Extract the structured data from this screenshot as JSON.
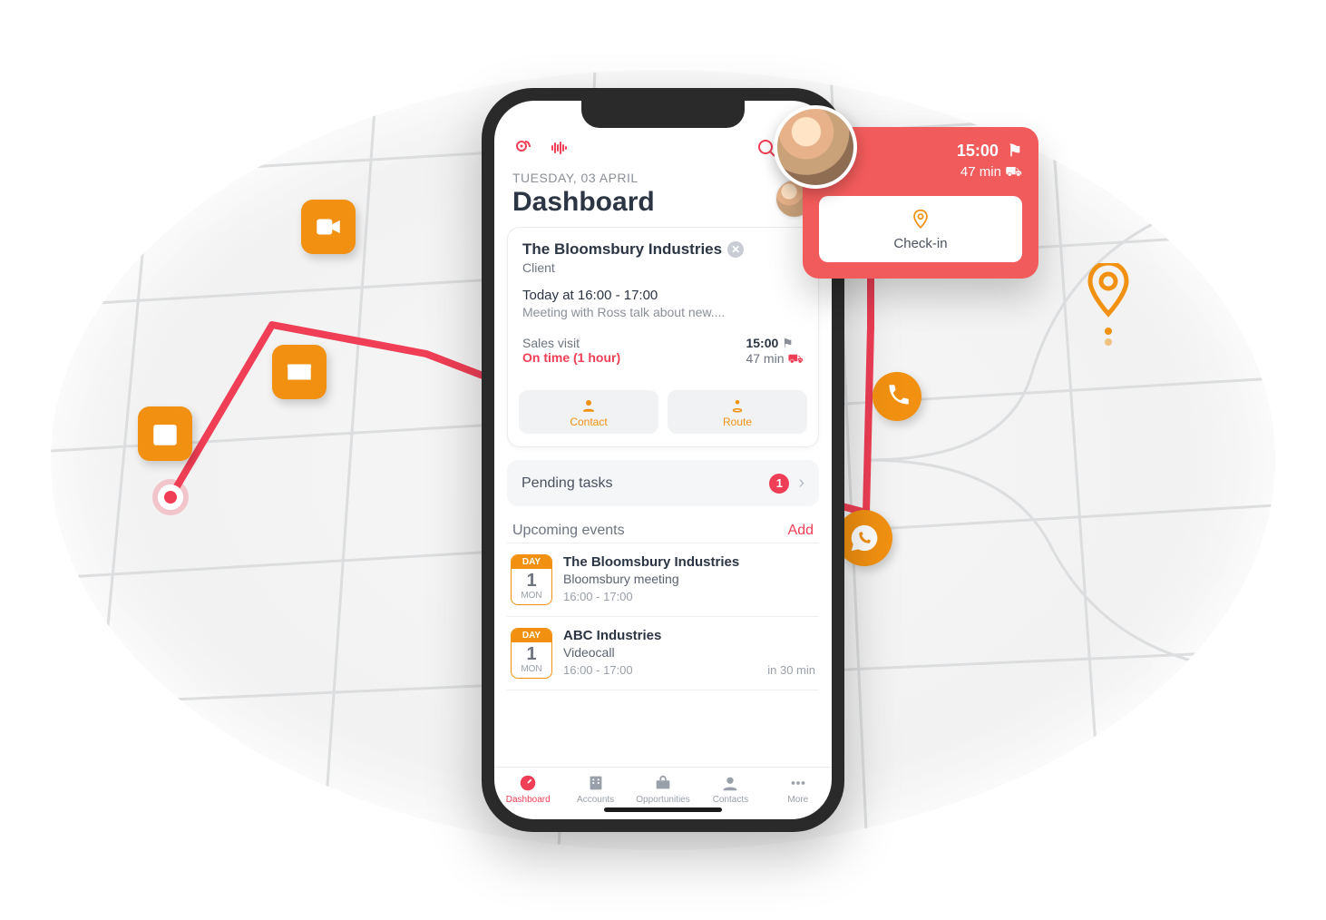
{
  "header": {
    "date_line": "TUESDAY, 03 APRIL",
    "title": "Dashboard"
  },
  "topbar_icons": {
    "logo": "app-logo-icon",
    "sound": "sound-wave-icon",
    "search": "search-icon",
    "bell": "bell-icon"
  },
  "client_card": {
    "name": "The Bloomsbury Industries",
    "type": "Client",
    "time_line": "Today at 16:00 - 17:00",
    "description": "Meeting with Ross talk about new....",
    "visit_label": "Sales visit",
    "status_label": "On time (1 hour)",
    "depart_time": "15:00",
    "travel_time": "47 min",
    "buttons": {
      "contact": "Contact",
      "route": "Route"
    }
  },
  "pending_tasks": {
    "label": "Pending tasks",
    "count": "1"
  },
  "upcoming": {
    "heading": "Upcoming events",
    "add_label": "Add",
    "events": [
      {
        "chip_top": "DAY",
        "chip_mid": "1",
        "chip_bot": "MON",
        "title": "The Bloomsbury Industries",
        "subtitle": "Bloomsbury meeting",
        "time": "16:00 - 17:00",
        "countdown": ""
      },
      {
        "chip_top": "DAY",
        "chip_mid": "1",
        "chip_bot": "MON",
        "title": "ABC Industries",
        "subtitle": "Videocall",
        "time": "16:00 - 17:00",
        "countdown": "in 30 min"
      }
    ]
  },
  "tabs": [
    {
      "label": "Dashboard",
      "active": true
    },
    {
      "label": "Accounts",
      "active": false
    },
    {
      "label": "Opportunities",
      "active": false
    },
    {
      "label": "Contacts",
      "active": false
    },
    {
      "label": "More",
      "active": false
    }
  ],
  "popover": {
    "time": "15:00",
    "travel": "47 min",
    "checkin_label": "Check-in"
  }
}
